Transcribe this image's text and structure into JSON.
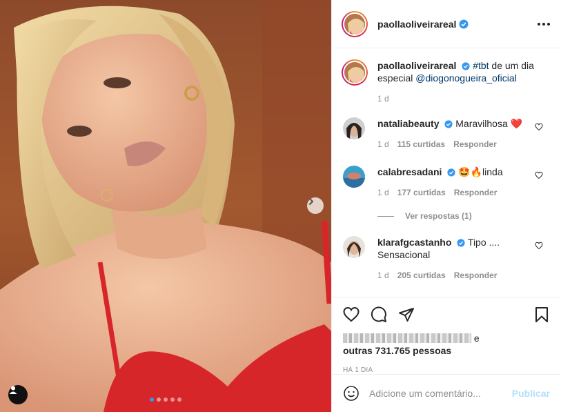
{
  "post": {
    "username": "paollaoliveirareal",
    "more_icon": "more-horizontal-icon",
    "photo": {
      "carousel_slides": 5,
      "active_slide": 1
    }
  },
  "caption": {
    "username": "paollaoliveirareal",
    "hashtag": "#tbt",
    "text_mid": " de um dia especial ",
    "mention": "@diogonogueira_oficial",
    "time": "1 d"
  },
  "comments": [
    {
      "username": "nataliabeauty",
      "verified": true,
      "text": "Maravilhosa ❤️",
      "time": "1 d",
      "likes": "115 curtidas",
      "reply": "Responder"
    },
    {
      "username": "calabresadani",
      "verified": true,
      "text": "🤩🔥linda",
      "time": "1 d",
      "likes": "177 curtidas",
      "reply": "Responder",
      "view_replies": "Ver respostas (1)"
    },
    {
      "username": "klarafgcastanho",
      "verified": true,
      "text": "Tipo .... Sensacional",
      "time": "1 d",
      "likes": "205 curtidas",
      "reply": "Responder"
    }
  ],
  "likes": {
    "prefix_char": "e",
    "others": "outras 731.765 pessoas"
  },
  "time_ago": "HÁ 1 DIA",
  "add_comment": {
    "placeholder": "Adicione um comentário...",
    "publish": "Publicar"
  },
  "colors": {
    "accent": "#3897f0",
    "link": "#00376b",
    "muted": "#8e8e8e",
    "publish_disabled": "#b2dffc"
  }
}
